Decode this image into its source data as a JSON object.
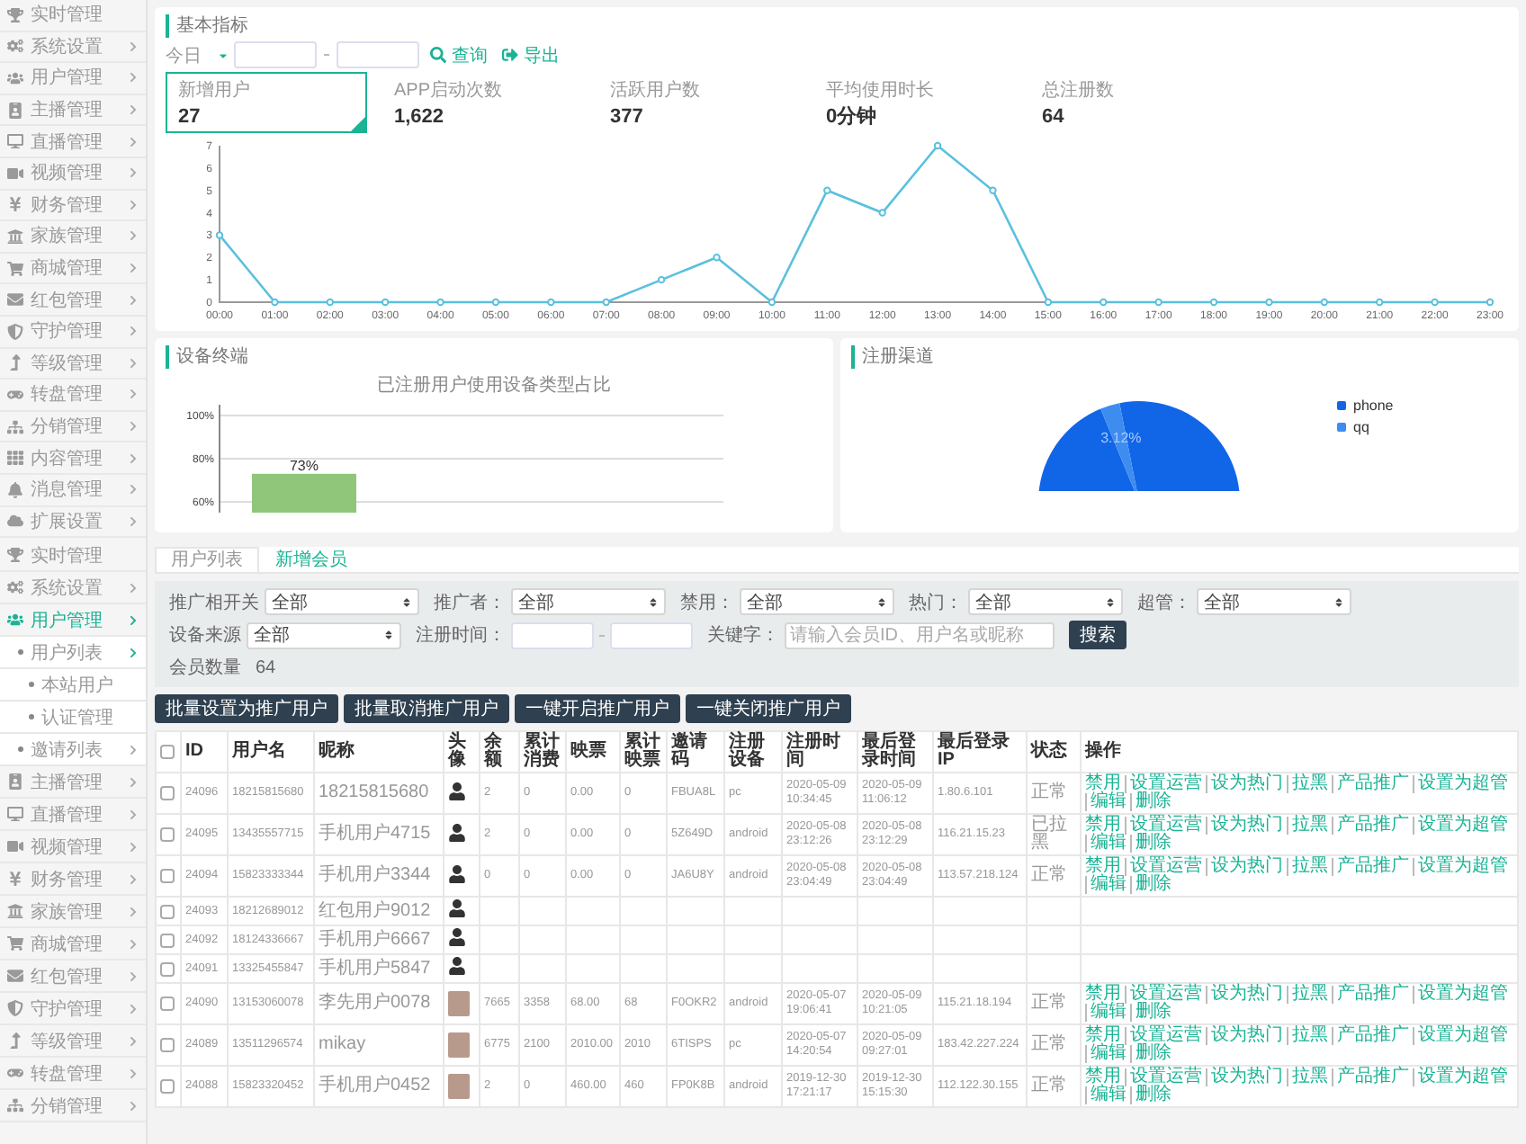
{
  "sidebar_top": {
    "items": [
      {
        "label": "实时管理",
        "kind": "link",
        "selected": false
      },
      {
        "label": "系统设置",
        "kind": "menu",
        "selected": false
      },
      {
        "label": "用户管理",
        "kind": "menu",
        "selected": false
      },
      {
        "label": "主播管理",
        "kind": "menu",
        "selected": false
      },
      {
        "label": "直播管理",
        "kind": "menu",
        "selected": false
      },
      {
        "label": "视频管理",
        "kind": "menu",
        "selected": false
      },
      {
        "label": "财务管理",
        "kind": "menu",
        "selected": false
      },
      {
        "label": "家族管理",
        "kind": "menu",
        "selected": false
      },
      {
        "label": "商城管理",
        "kind": "menu",
        "selected": false
      },
      {
        "label": "红包管理",
        "kind": "menu",
        "selected": false
      },
      {
        "label": "守护管理",
        "kind": "menu",
        "selected": false
      },
      {
        "label": "等级管理",
        "kind": "menu",
        "selected": false
      },
      {
        "label": "转盘管理",
        "kind": "menu",
        "selected": false
      },
      {
        "label": "分销管理",
        "kind": "menu",
        "selected": false
      },
      {
        "label": "内容管理",
        "kind": "menu",
        "selected": false
      },
      {
        "label": "消息管理",
        "kind": "menu",
        "selected": false
      },
      {
        "label": "扩展设置",
        "kind": "menu",
        "selected": false
      }
    ]
  },
  "basic_metrics": {
    "title": "基本指标",
    "period": "今日",
    "query_button": "查询",
    "export_button": "导出",
    "stats": [
      {
        "label": "新增用户",
        "value": "27",
        "selected": true
      },
      {
        "label": "APP启动次数",
        "value": "1,622",
        "selected": false
      },
      {
        "label": "活跃用户数",
        "value": "377",
        "selected": false
      },
      {
        "label": "平均使用时长",
        "value": "0分钟",
        "selected": false
      },
      {
        "label": "总注册数",
        "value": "64",
        "selected": false
      }
    ],
    "chart_data": {
      "type": "line",
      "categories": [
        "00:00",
        "01:00",
        "02:00",
        "03:00",
        "04:00",
        "05:00",
        "06:00",
        "07:00",
        "08:00",
        "09:00",
        "10:00",
        "11:00",
        "12:00",
        "13:00",
        "14:00",
        "15:00",
        "16:00",
        "17:00",
        "18:00",
        "19:00",
        "20:00",
        "21:00",
        "22:00",
        "23:00"
      ],
      "series": [
        {
          "color": "#5bc0de",
          "marker": true,
          "values": [
            3,
            0,
            0,
            0,
            0,
            0,
            0,
            0,
            1,
            2,
            0,
            5,
            4,
            7,
            5,
            0,
            0,
            0,
            0,
            0,
            0,
            0,
            0,
            0
          ]
        }
      ],
      "ylim": [
        0,
        7
      ],
      "yticks": [
        0,
        1,
        2,
        3,
        4,
        5,
        6,
        7
      ]
    }
  },
  "device_card": {
    "title": "设备终端",
    "chart_data": {
      "type": "bar",
      "title": "已注册用户使用设备类型占比",
      "values": [
        73
      ],
      "ylim": [
        55,
        100
      ],
      "yticks": [
        {
          "value": 60,
          "label": "60%"
        },
        {
          "value": 80,
          "label": "80%"
        },
        {
          "value": 100,
          "label": "100%"
        }
      ],
      "value_labels": [
        "73%"
      ]
    }
  },
  "channel_card": {
    "title": "注册渠道",
    "chart_data": {
      "type": "pie",
      "categories": [
        "phone",
        "qq"
      ],
      "values": [
        96.88,
        3.12
      ],
      "value_labels": [
        null,
        "3.12%"
      ]
    }
  },
  "sidebar_bottom": {
    "items": [
      {
        "label": "实时管理",
        "kind": "link",
        "selected": false
      },
      {
        "label": "系统设置",
        "kind": "menu",
        "selected": false
      },
      {
        "label": "用户管理",
        "kind": "menu",
        "selected": true,
        "expanded": true,
        "children": [
          {
            "label": "用户列表",
            "kind": "menu",
            "selected": false,
            "expanded": true,
            "children": [
              {
                "label": "本站用户",
                "kind": "link",
                "selected": false
              },
              {
                "label": "认证管理",
                "kind": "link",
                "selected": false
              }
            ]
          },
          {
            "label": "邀请列表",
            "kind": "menu",
            "selected": false
          }
        ]
      },
      {
        "label": "主播管理",
        "kind": "menu",
        "selected": false
      },
      {
        "label": "直播管理",
        "kind": "menu",
        "selected": false
      },
      {
        "label": "视频管理",
        "kind": "menu",
        "selected": false
      },
      {
        "label": "财务管理",
        "kind": "menu",
        "selected": false
      },
      {
        "label": "家族管理",
        "kind": "menu",
        "selected": false
      },
      {
        "label": "商城管理",
        "kind": "menu",
        "selected": false
      },
      {
        "label": "红包管理",
        "kind": "menu",
        "selected": false
      },
      {
        "label": "守护管理",
        "kind": "menu",
        "selected": false
      },
      {
        "label": "等级管理",
        "kind": "menu",
        "selected": false
      },
      {
        "label": "转盘管理",
        "kind": "menu",
        "selected": false
      },
      {
        "label": "分销管理",
        "kind": "menu",
        "selected": false
      }
    ]
  },
  "tabs": [
    {
      "label": "用户列表",
      "selected": true
    },
    {
      "label": "新增会员",
      "selected": false
    }
  ],
  "filters": {
    "fields": [
      {
        "kind": "select",
        "label": "推广相开关",
        "value": "全部"
      },
      {
        "kind": "select",
        "label": "推广者：",
        "value": "全部"
      },
      {
        "kind": "select",
        "label": "禁用：",
        "value": "全部"
      },
      {
        "kind": "select",
        "label": "热门：",
        "value": "全部"
      },
      {
        "kind": "select",
        "label": "超管：",
        "value": "全部"
      },
      {
        "kind": "select",
        "label": "设备来源",
        "value": "全部"
      },
      {
        "kind": "daterange",
        "label": "注册时间："
      },
      {
        "kind": "text",
        "label": "关键字：",
        "placeholder": "请输入会员ID、用户名或昵称"
      },
      {
        "kind": "button",
        "label": "搜索"
      }
    ],
    "count_label": "会员数量",
    "count": "64"
  },
  "bulk_buttons": [
    "批量设置为推广用户",
    "批量取消推广用户",
    "一键开启推广用户",
    "一键关闭推广用户"
  ],
  "table": {
    "select_all_checked": false,
    "columns": [
      "ID",
      "用户名",
      "昵称",
      "头像",
      "余额",
      "累计消费",
      "映票",
      "累计映票",
      "邀请码",
      "注册设备",
      "注册时间",
      "最后登录时间",
      "最后登录IP",
      "状态",
      "操作"
    ],
    "rows": [
      {
        "checked": false,
        "id": "24096",
        "username": "18215815680",
        "nickname": "18215815680",
        "avatar": {
          "kind": "cartoon"
        },
        "balance": "2",
        "total_spent": "0",
        "tickets": "0.00",
        "total_tickets": "0",
        "invite_code": "FBUA8L",
        "device": "pc",
        "registered": "2020-05-09 10:34:45",
        "last_login": "2020-05-09 11:06:12",
        "last_ip": "1.80.6.101",
        "status": "正常",
        "actions": [
          "禁用",
          "设置运营",
          "设为热门",
          "拉黑",
          "产品推广",
          "设置为超管",
          "编辑",
          "删除"
        ]
      },
      {
        "checked": false,
        "id": "24095",
        "username": "13435557715",
        "nickname": "手机用户4715",
        "avatar": {
          "kind": "cartoon"
        },
        "balance": "2",
        "total_spent": "0",
        "tickets": "0.00",
        "total_tickets": "0",
        "invite_code": "5Z649D",
        "device": "android",
        "registered": "2020-05-08 23:12:26",
        "last_login": "2020-05-08 23:12:29",
        "last_ip": "116.21.15.23",
        "status": "已拉黑",
        "actions": [
          "禁用",
          "设置运营",
          "设为热门",
          "拉黑",
          "产品推广",
          "设置为超管",
          "编辑",
          "删除"
        ]
      },
      {
        "checked": false,
        "id": "24094",
        "username": "15823333344",
        "nickname": "手机用户3344",
        "avatar": {
          "kind": "cartoon"
        },
        "balance": "0",
        "total_spent": "0",
        "tickets": "0.00",
        "total_tickets": "0",
        "invite_code": "JA6U8Y",
        "device": "android",
        "registered": "2020-05-08 23:04:49",
        "last_login": "2020-05-08 23:04:49",
        "last_ip": "113.57.218.124",
        "status": "正常",
        "actions": [
          "禁用",
          "设置运营",
          "设为热门",
          "拉黑",
          "产品推广",
          "设置为超管",
          "编辑",
          "删除"
        ]
      },
      {
        "checked": false,
        "id": "24093",
        "username": "18212689012",
        "nickname": "红包用户9012",
        "avatar": {
          "kind": "cartoon"
        }
      },
      {
        "checked": false,
        "id": "24092",
        "username": "18124336667",
        "nickname": "手机用户6667",
        "avatar": {
          "kind": "cartoon"
        }
      },
      {
        "checked": false,
        "id": "24091",
        "username": "13325455847",
        "nickname": "手机用户5847",
        "avatar": {
          "kind": "cartoon"
        }
      },
      {
        "checked": false,
        "id": "24090",
        "username": "13153060078",
        "nickname": "李先用户0078",
        "avatar": {
          "kind": "photo"
        },
        "balance": "7665",
        "total_spent": "3358",
        "tickets": "68.00",
        "total_tickets": "68",
        "invite_code": "F0OKR2",
        "device": "android",
        "registered": "2020-05-07 19:06:41",
        "last_login": "2020-05-09 10:21:05",
        "last_ip": "115.21.18.194",
        "status": "正常",
        "actions": [
          "禁用",
          "设置运营",
          "设为热门",
          "拉黑",
          "产品推广",
          "设置为超管",
          "编辑",
          "删除"
        ]
      },
      {
        "checked": false,
        "id": "24089",
        "username": "13511296574",
        "nickname": "mikay",
        "avatar": {
          "kind": "photo"
        },
        "balance": "6775",
        "total_spent": "2100",
        "tickets": "2010.00",
        "total_tickets": "2010",
        "invite_code": "6TISPS",
        "device": "pc",
        "registered": "2020-05-07 14:20:54",
        "last_login": "2020-05-09 09:27:01",
        "last_ip": "183.42.227.224",
        "status": "正常",
        "actions": [
          "禁用",
          "设置运营",
          "设为热门",
          "拉黑",
          "产品推广",
          "设置为超管",
          "编辑",
          "删除"
        ]
      },
      {
        "checked": false,
        "id": "24088",
        "username": "15823320452",
        "nickname": "手机用户0452",
        "avatar": {
          "kind": "photo"
        },
        "balance": "2",
        "total_spent": "0",
        "tickets": "460.00",
        "total_tickets": "460",
        "invite_code": "FP0K8B",
        "device": "android",
        "registered": "2019-12-30 17:21:17",
        "last_login": "2019-12-30 15:15:30",
        "last_ip": "112.122.30.155",
        "status": "正常",
        "actions": [
          "禁用",
          "设置运营",
          "设为热门",
          "拉黑",
          "产品推广",
          "设置为超管",
          "编辑",
          "删除"
        ]
      }
    ]
  }
}
